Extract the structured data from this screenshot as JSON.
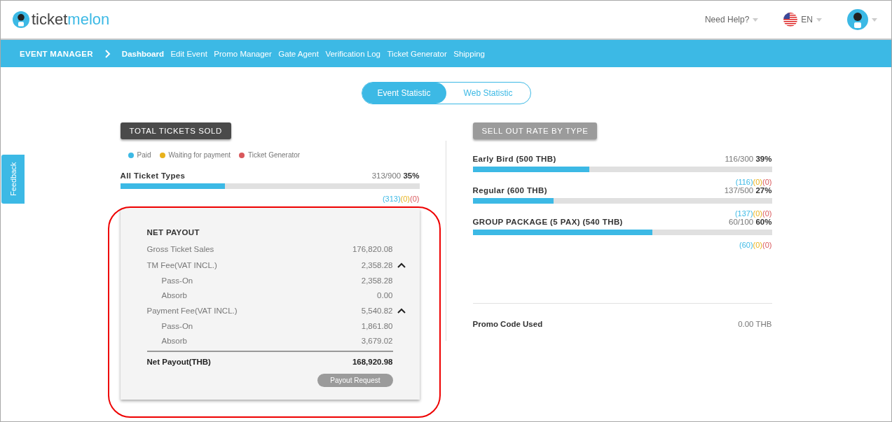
{
  "header": {
    "logo": {
      "dark": "ticket",
      "light": "melon"
    },
    "help": "Need Help?",
    "language": "EN"
  },
  "nav": {
    "section": "EVENT MANAGER",
    "items": [
      {
        "label": "Dashboard",
        "selected": true
      },
      {
        "label": "Edit Event",
        "selected": false
      },
      {
        "label": "Promo Manager",
        "selected": false
      },
      {
        "label": "Gate Agent",
        "selected": false
      },
      {
        "label": "Verification Log",
        "selected": false
      },
      {
        "label": "Ticket Generator",
        "selected": false
      },
      {
        "label": "Shipping",
        "selected": false
      }
    ]
  },
  "toggle": [
    {
      "label": "Event Statistic",
      "selected": true
    },
    {
      "label": "Web Statistic",
      "selected": false
    }
  ],
  "feedback": "Feedback",
  "total": {
    "title": "TOTAL TICKETS SOLD",
    "legend": [
      {
        "label": "Paid",
        "color": "#3cb9e5"
      },
      {
        "label": "Waiting for payment",
        "color": "#e8b21c"
      },
      {
        "label": "Ticket Generator",
        "color": "#d9585c"
      }
    ],
    "row": {
      "label": "All Ticket Types",
      "count": "313/900",
      "percent": "35%",
      "level": 0.35,
      "breakdown": [
        "(313)",
        "(0)",
        "(0)"
      ]
    }
  },
  "payout": {
    "title": "NET PAYOUT",
    "lines": [
      {
        "kind": "line",
        "label": "Gross Ticket Sales",
        "value": "176,820.08"
      },
      {
        "kind": "group",
        "label": "TM Fee(VAT INCL.)",
        "value": "2,358.28",
        "expanded": true
      },
      {
        "kind": "sub",
        "label": "Pass-On",
        "value": "2,358.28"
      },
      {
        "kind": "sub",
        "label": "Absorb",
        "value": "0.00"
      },
      {
        "kind": "group",
        "label": "Payment Fee(VAT INCL.)",
        "value": "5,540.82",
        "expanded": true
      },
      {
        "kind": "sub",
        "label": "Pass-On",
        "value": "1,861.80"
      },
      {
        "kind": "sub",
        "label": "Absorb",
        "value": "3,679.02"
      }
    ],
    "total_label": "Net Payout(THB)",
    "total_value": "168,920.98",
    "button": "Payout Request"
  },
  "sellout": {
    "title": "SELL OUT RATE BY TYPE",
    "rows": [
      {
        "label": "Early Bird (500 THB)",
        "count": "116/300",
        "percent": "39%",
        "level": 0.39,
        "breakdown": [
          "(116)",
          "(0)",
          "(0)"
        ]
      },
      {
        "label": "Regular (600 THB)",
        "count": "137/500",
        "percent": "27%",
        "level": 0.27,
        "breakdown": [
          "(137)",
          "(0)",
          "(0)"
        ]
      },
      {
        "label": "GROUP PACKAGE (5 PAX) (540 THB)",
        "count": "60/100",
        "percent": "60%",
        "level": 0.6,
        "breakdown": [
          "(60)",
          "(0)",
          "(0)"
        ]
      }
    ],
    "promo": {
      "label": "Promo Code Used",
      "value": "0.00 THB"
    }
  }
}
